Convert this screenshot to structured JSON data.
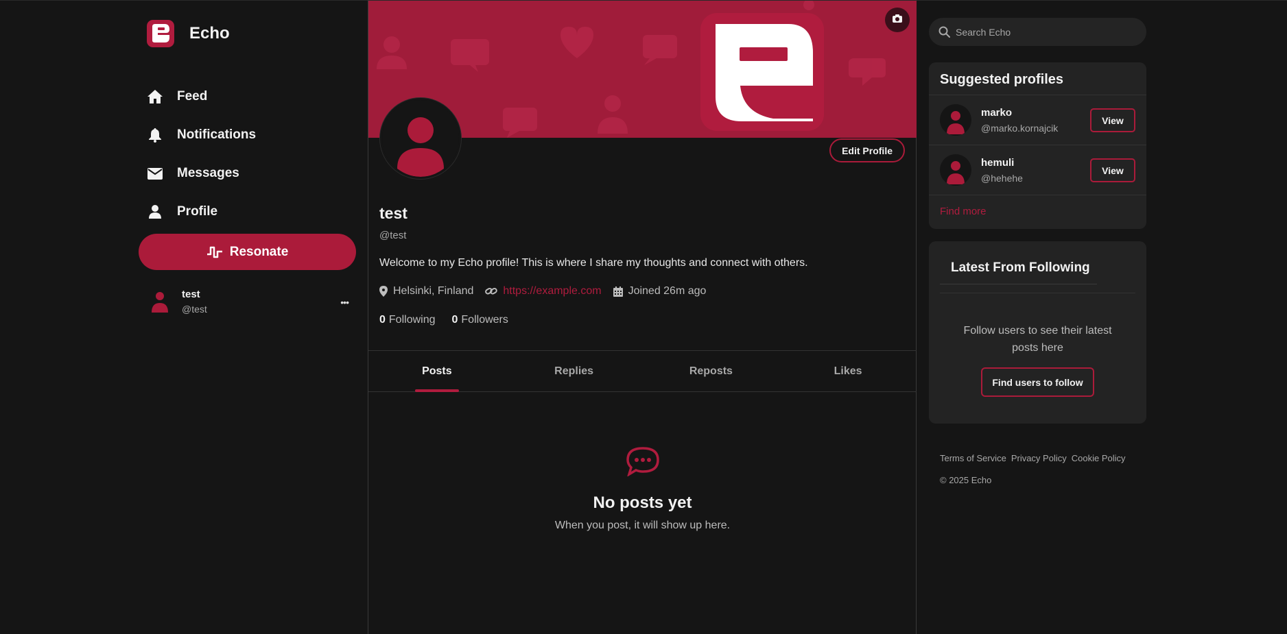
{
  "brand": {
    "name": "Echo",
    "accent": "#b01c3e"
  },
  "nav": {
    "items": [
      {
        "label": "Feed",
        "icon": "home-icon"
      },
      {
        "label": "Notifications",
        "icon": "bell-icon"
      },
      {
        "label": "Messages",
        "icon": "envelope-icon"
      },
      {
        "label": "Profile",
        "icon": "user-icon"
      }
    ],
    "resonate_label": "Resonate"
  },
  "current_user": {
    "name": "test",
    "handle": "@test",
    "more": "•••"
  },
  "profile": {
    "name": "test",
    "handle": "@test",
    "edit_label": "Edit Profile",
    "bio": "Welcome to my Echo profile! This is where I share my thoughts and connect with others.",
    "location": "Helsinki, Finland",
    "website": "https://example.com",
    "joined": "Joined 26m ago",
    "following_count": "0",
    "following_label": "Following",
    "followers_count": "0",
    "followers_label": "Followers"
  },
  "tabs": [
    "Posts",
    "Replies",
    "Reposts",
    "Likes"
  ],
  "active_tab": "Posts",
  "empty_state": {
    "title": "No posts yet",
    "subtitle": "When you post, it will show up here."
  },
  "search": {
    "placeholder": "Search Echo"
  },
  "suggested": {
    "title": "Suggested profiles",
    "profiles": [
      {
        "name": "marko",
        "handle": "@marko.kornajcik",
        "action": "View"
      },
      {
        "name": "hemuli",
        "handle": "@hehehe",
        "action": "View"
      }
    ],
    "find_more": "Find more"
  },
  "latest": {
    "title": "Latest From Following",
    "message": "Follow users to see their latest posts here",
    "button": "Find users to follow"
  },
  "footer": {
    "links": [
      "Terms of Service",
      "Privacy Policy",
      "Cookie Policy"
    ],
    "copyright": "© 2025 Echo"
  }
}
